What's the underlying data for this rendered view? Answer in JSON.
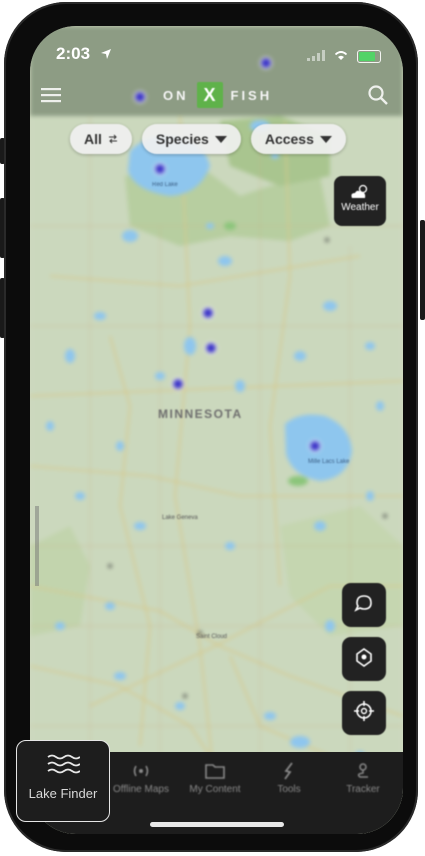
{
  "status_bar": {
    "time": "2:03",
    "battery": "100"
  },
  "header": {
    "logo_left": "ON",
    "logo_mark": "X",
    "logo_right": "FISH"
  },
  "filters": [
    {
      "label": "All"
    },
    {
      "label": "Species"
    },
    {
      "label": "Access"
    }
  ],
  "weather": {
    "label": "Weather"
  },
  "map": {
    "state_label": "MINNESOTA",
    "lake_label_1": "Red Lake",
    "lake_label_2": "Mille Lacs Lake",
    "city_label": "Saint Cloud",
    "town_label": "Lake Geneva"
  },
  "tabs": [
    {
      "label": "Lake Finder"
    },
    {
      "label": "Offline Maps"
    },
    {
      "label": "My Content"
    },
    {
      "label": "Tools"
    },
    {
      "label": "Tracker"
    }
  ],
  "colors": {
    "accent": "#5fb24a",
    "pin": "#3c35c7",
    "water": "#8ec6ee",
    "tab_bar": "#1d1d1d"
  }
}
